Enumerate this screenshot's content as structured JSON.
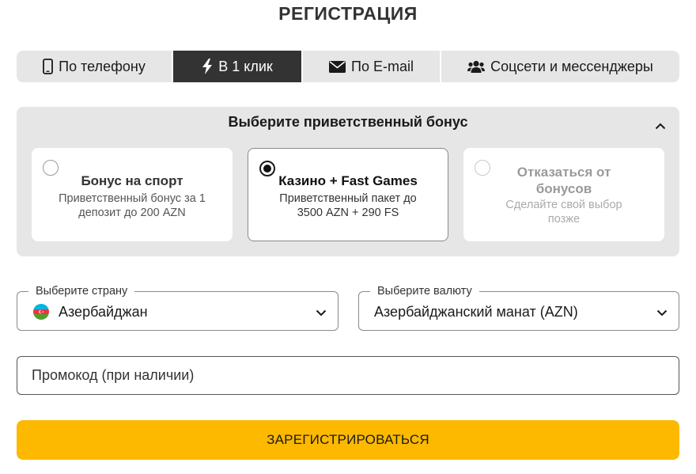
{
  "page": {
    "title": "РЕГИСТРАЦИЯ"
  },
  "tabs": [
    {
      "label": "По телефону",
      "icon": "phone-icon",
      "active": false
    },
    {
      "label": "В 1 клик",
      "icon": "lightning-icon",
      "active": true
    },
    {
      "label": "По E-mail",
      "icon": "envelope-icon",
      "active": false
    },
    {
      "label": "Соцсети и мессенджеры",
      "icon": "users-icon",
      "active": false
    }
  ],
  "bonus": {
    "heading": "Выберите приветственный бонус",
    "options": [
      {
        "title": "Бонус на спорт",
        "description": "Приветственный бонус за 1 депозит до 200 AZN",
        "selected": false
      },
      {
        "title": "Казино + Fast Games",
        "description": "Приветственный пакет до 3500 AZN + 290 FS",
        "selected": true
      },
      {
        "title": "Отказаться от бонусов",
        "description": "Сделайте свой выбор позже",
        "selected": false
      }
    ]
  },
  "country": {
    "label": "Выберите страну",
    "value": "Азербайджан",
    "flag": "azerbaijan-flag-icon"
  },
  "currency": {
    "label": "Выберите валюту",
    "value": "Азербайджанский манат (AZN)"
  },
  "promo": {
    "placeholder": "Промокод (при наличии)",
    "value": ""
  },
  "submit": {
    "label": "ЗАРЕГИСТРИРОВАТЬСЯ"
  },
  "colors": {
    "accent": "#fcb900",
    "active_tab": "#333333",
    "panel_bg": "#e6e6e6",
    "flag_blue": "#00b5e2",
    "flag_red": "#ef3340",
    "flag_green": "#509e2f"
  }
}
